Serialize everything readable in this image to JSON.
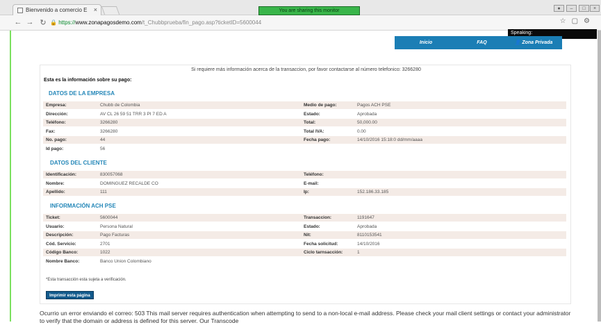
{
  "browser": {
    "tab_title": "Bienvenido a comercio E",
    "tab_close": "×",
    "share_banner": "You are sharing this monitor",
    "url_proto": "https://",
    "url_host": "www.zonapagosdemo.com",
    "url_path": "/t_Chubbprueba/fin_pago.asp?ticketID=5600044",
    "speaking_label": "Speaking:"
  },
  "nav": {
    "inicio": "Inicio",
    "faq": "FAQ",
    "zona_privada": "Zona Privada"
  },
  "page": {
    "info_top": "Si requiere más información acerca de la transaccion, por favor contactarse al número telefonico: 3266280",
    "info_title": "Esta es la información sobre su pago:",
    "section_empresa": "DATOS DE LA EMPRESA",
    "section_cliente": "DATOS DEL CLIENTE",
    "section_ach": "INFORMACIÓN ACH PSE",
    "empresa_rows": [
      {
        "l1": "Empresa:",
        "v1": "Chubb de Colombia",
        "l2": "Medio de pago:",
        "v2": "Pagos ACH PSE"
      },
      {
        "l1": "Dirección:",
        "v1": "AV CL 26 59 51 TRR 3 PI 7 ED A",
        "l2": "Estado:",
        "v2": "Aprobada"
      },
      {
        "l1": "Teléfono:",
        "v1": "3266280",
        "l2": "Total:",
        "v2": "50,000.00"
      },
      {
        "l1": "Fax:",
        "v1": "3266280",
        "l2": "Total IVA:",
        "v2": "0.00"
      },
      {
        "l1": "No. pago:",
        "v1": "44",
        "l2": "Fecha pago:",
        "v2": "14/10/2016 15:18:0 dd/mm/aaaa"
      },
      {
        "l1": "Id pago:",
        "v1": "56",
        "l2": "",
        "v2": ""
      }
    ],
    "cliente_rows": [
      {
        "l1": "Identificación:",
        "v1": "830057068",
        "l2": "Teléfono:",
        "v2": ""
      },
      {
        "l1": "Nombre:",
        "v1": "DOMINGUEZ RECALDE CO",
        "l2": "E-mail:",
        "v2": ""
      },
      {
        "l1": "Apellido:",
        "v1": "111",
        "l2": "Ip:",
        "v2": "152.186.33.185"
      }
    ],
    "ach_rows": [
      {
        "l1": "Ticket:",
        "v1": "5600044",
        "l2": "Transaccion:",
        "v2": "1191647"
      },
      {
        "l1": "Usuario:",
        "v1": "Persona Natural",
        "l2": "Estado:",
        "v2": "Aprobada"
      },
      {
        "l1": "Descripción:",
        "v1": "Pago Facturas",
        "l2": "Nit:",
        "v2": "8110153541"
      },
      {
        "l1": "Cód. Servicio:",
        "v1": "2701",
        "l2": "Fecha solicitud:",
        "v2": "14/10/2016"
      },
      {
        "l1": "Código Banco:",
        "v1": "1022",
        "l2": "Ciclo tarnsacción:",
        "v2": "1"
      },
      {
        "l1": "Nombre Banco:",
        "v1": "Banco Union Colombiano",
        "l2": "",
        "v2": ""
      }
    ],
    "note": "*Esta transacción esta sujeta a verificación.",
    "print_button": "Imprimir esta página"
  },
  "error_msg": "Ocurrio un error enviando el correo: 503 This mail server requires authentication when attempting to send to a non-local e-mail address. Please check your mail client settings or contact your administrator to verify that the domain or address is defined for this server. Our Transcode"
}
